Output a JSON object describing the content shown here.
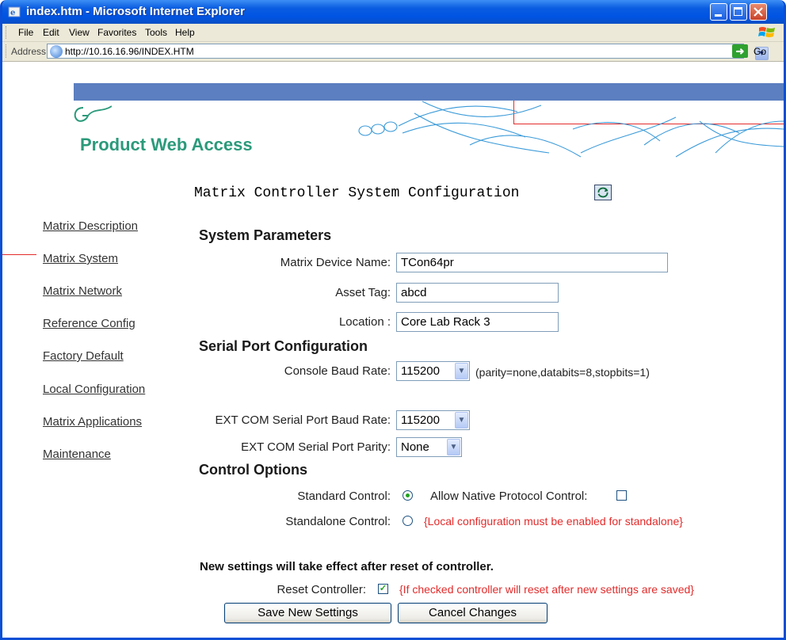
{
  "window": {
    "title": "index.htm - Microsoft Internet Explorer"
  },
  "menu": [
    "File",
    "Edit",
    "View",
    "Favorites",
    "Tools",
    "Help"
  ],
  "address": {
    "label": "Address",
    "url": "http://10.16.16.96/INDEX.HTM",
    "go_label": "Go"
  },
  "header": {
    "brand": "Product Web Access",
    "page_title": "Matrix Controller System Configuration"
  },
  "nav": {
    "items": [
      {
        "label": "Matrix Description"
      },
      {
        "label": "Matrix System"
      },
      {
        "label": "Matrix Network"
      },
      {
        "label": "Reference Config"
      },
      {
        "label": "Factory Default"
      },
      {
        "label": "Local Configuration"
      },
      {
        "label": "Matrix Applications"
      },
      {
        "label": "Maintenance"
      }
    ]
  },
  "system_params": {
    "heading": "System Parameters",
    "device_name_label": "Matrix Device Name:",
    "device_name_value": "TCon64pr",
    "asset_tag_label": "Asset Tag:",
    "asset_tag_value": "abcd",
    "location_label": "Location :",
    "location_value": "Core Lab Rack 3"
  },
  "serial": {
    "heading": "Serial Port Configuration",
    "console_baud_label": "Console Baud Rate:",
    "console_baud_value": "115200",
    "console_baud_note": "(parity=none,databits=8,stopbits=1)",
    "ext_baud_label": "EXT COM Serial Port Baud Rate:",
    "ext_baud_value": "115200",
    "ext_parity_label": "EXT COM Serial Port Parity:",
    "ext_parity_value": "None"
  },
  "control": {
    "heading": "Control Options",
    "standard_label": "Standard Control:",
    "standard_selected": true,
    "native_label": "Allow Native Protocol Control:",
    "native_checked": false,
    "standalone_label": "Standalone Control:",
    "standalone_selected": false,
    "standalone_note": "{Local configuration must be enabled for standalone}"
  },
  "reset": {
    "notice": "New settings will take effect after reset of controller.",
    "label": "Reset Controller:",
    "checked": true,
    "note": "{If checked controller will reset after new settings are saved}"
  },
  "buttons": {
    "save": "Save New Settings",
    "cancel": "Cancel Changes"
  },
  "colors": {
    "accent_red": "#e32b2b",
    "brand_teal": "#2b9a7a",
    "band_blue": "#5b7fc0",
    "xp_blue": "#0054e3"
  }
}
